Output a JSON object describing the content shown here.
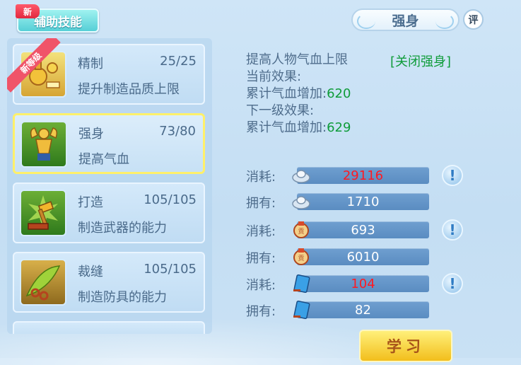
{
  "header": {
    "tab_label": "辅助技能",
    "new_badge": "新"
  },
  "title": {
    "text": "强身",
    "eval_label": "评"
  },
  "skills": [
    {
      "name": "精制",
      "level": "25/25",
      "desc": "提升制造品质上限",
      "ribbon": "新等级",
      "icon": "refine-potion-icon"
    },
    {
      "name": "强身",
      "level": "73/80",
      "desc": "提高气血",
      "icon": "muscle-man-icon",
      "selected": true
    },
    {
      "name": "打造",
      "level": "105/105",
      "desc": "制造武器的能力",
      "icon": "hammer-anvil-icon"
    },
    {
      "name": "裁缝",
      "level": "105/105",
      "desc": "制造防具的能力",
      "icon": "scissors-leaf-icon"
    }
  ],
  "info": {
    "line1": "提高人物气血上限",
    "close_link": "[关闭强身]",
    "current_label": "当前效果:",
    "current_stat_label": "累计气血增加:",
    "current_stat_value": "620",
    "next_label": "下一级效果:",
    "next_stat_label": "累计气血增加:",
    "next_stat_value": "629"
  },
  "costs": [
    {
      "label": "消耗:",
      "value": "29116",
      "icon": "silver-ingot-icon",
      "insufficient": true,
      "warn": "!"
    },
    {
      "label": "拥有:",
      "value": "1710",
      "icon": "silver-ingot-icon"
    },
    {
      "label": "消耗:",
      "value": "693",
      "icon": "contribution-medal-icon",
      "warn": "!"
    },
    {
      "label": "拥有:",
      "value": "6010",
      "icon": "contribution-medal-icon"
    },
    {
      "label": "消耗:",
      "value": "104",
      "icon": "skill-book-icon",
      "insufficient": true,
      "warn": "!"
    },
    {
      "label": "拥有:",
      "value": "82",
      "icon": "skill-book-icon"
    }
  ],
  "learn_button": "学习",
  "colors": {
    "accent_green": "#0f9c3a",
    "insufficient_red": "#ff1a22",
    "selected_border": "#fff06a"
  }
}
